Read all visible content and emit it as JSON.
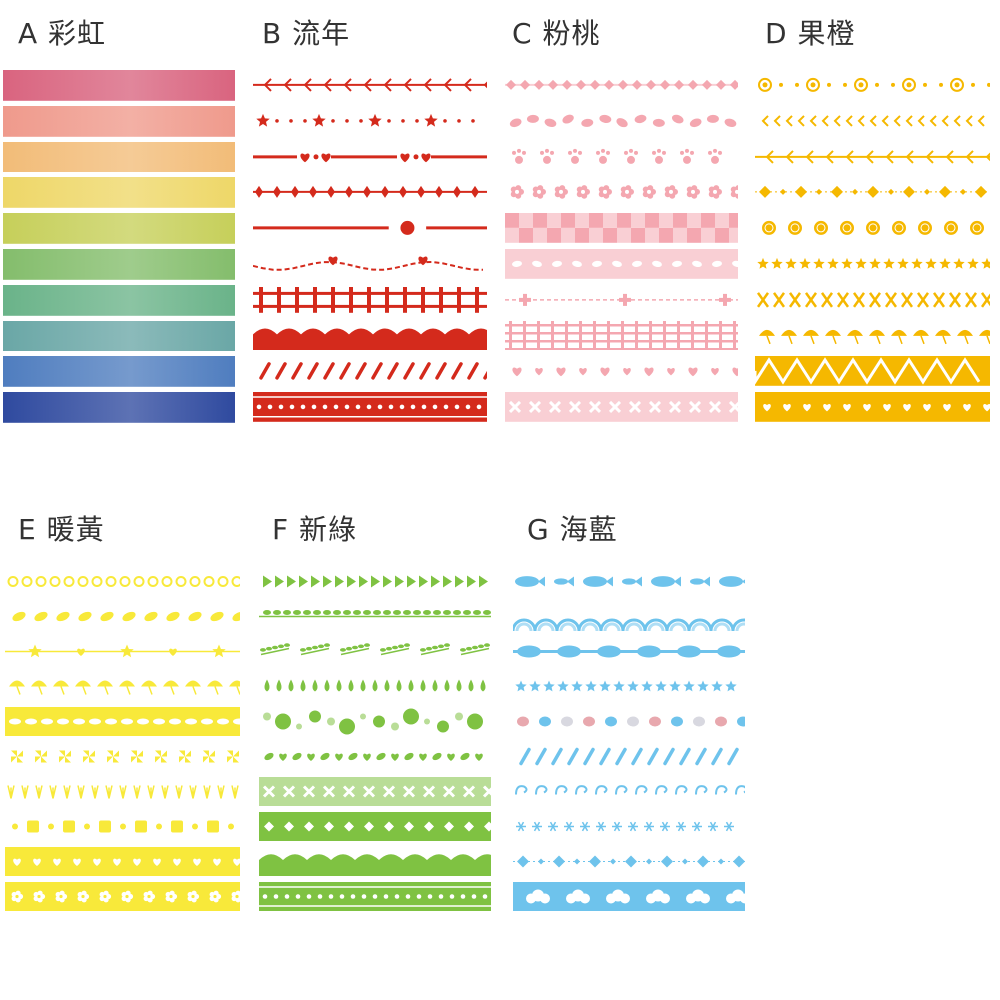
{
  "sets": [
    {
      "id": "A",
      "title": "A 彩虹",
      "color": "#e04a3c"
    },
    {
      "id": "B",
      "title": "B 流年",
      "color": "#d42a1c"
    },
    {
      "id": "C",
      "title": "C 粉桃",
      "color": "#f4a7b0"
    },
    {
      "id": "D",
      "title": "D 果橙",
      "color": "#f5b800"
    },
    {
      "id": "E",
      "title": "E 暖黃",
      "color": "#f8e93a"
    },
    {
      "id": "F",
      "title": "F 新綠",
      "color": "#7fc242"
    },
    {
      "id": "G",
      "title": "G 海藍",
      "color": "#6ec3ec"
    }
  ],
  "rainbow_colors": [
    "#d9647f",
    "#ef9a8c",
    "#f2bc78",
    "#eed768",
    "#c6cf5a",
    "#84bd6c",
    "#6ab389",
    "#6aa7a6",
    "#4f7dbf",
    "#2f4a9f"
  ],
  "tape_patterns": {
    "B": [
      "arrows",
      "stars-dots",
      "line-hearts",
      "cross-stitch",
      "line-dot",
      "wavy-hearts",
      "fence",
      "scallop",
      "dashes",
      "dots-band"
    ],
    "C": [
      "diamond-chain",
      "petals",
      "paws",
      "flowers",
      "checker",
      "leaf-band",
      "plus-dash",
      "lattice",
      "hearts",
      "x-band"
    ],
    "D": [
      "spirals",
      "chevrons",
      "arrows",
      "diamonds",
      "lemons",
      "stars",
      "x-chain",
      "umbrellas",
      "zigzag",
      "hearts-band"
    ],
    "E": [
      "swirls",
      "leaves",
      "star-line",
      "umbrellas",
      "wave-band",
      "pinwheels",
      "grass",
      "squares",
      "hearts-band",
      "flowers-band"
    ],
    "F": [
      "triangles",
      "vines",
      "sprigs",
      "drops",
      "bubbles",
      "hearts-leaves",
      "x-band",
      "diamond-band",
      "scallop",
      "dots-band"
    ],
    "G": [
      "fish",
      "arches",
      "bead-chain",
      "stars",
      "pebbles",
      "dashes",
      "waves",
      "snowflakes",
      "diamonds",
      "clouds-band"
    ]
  }
}
